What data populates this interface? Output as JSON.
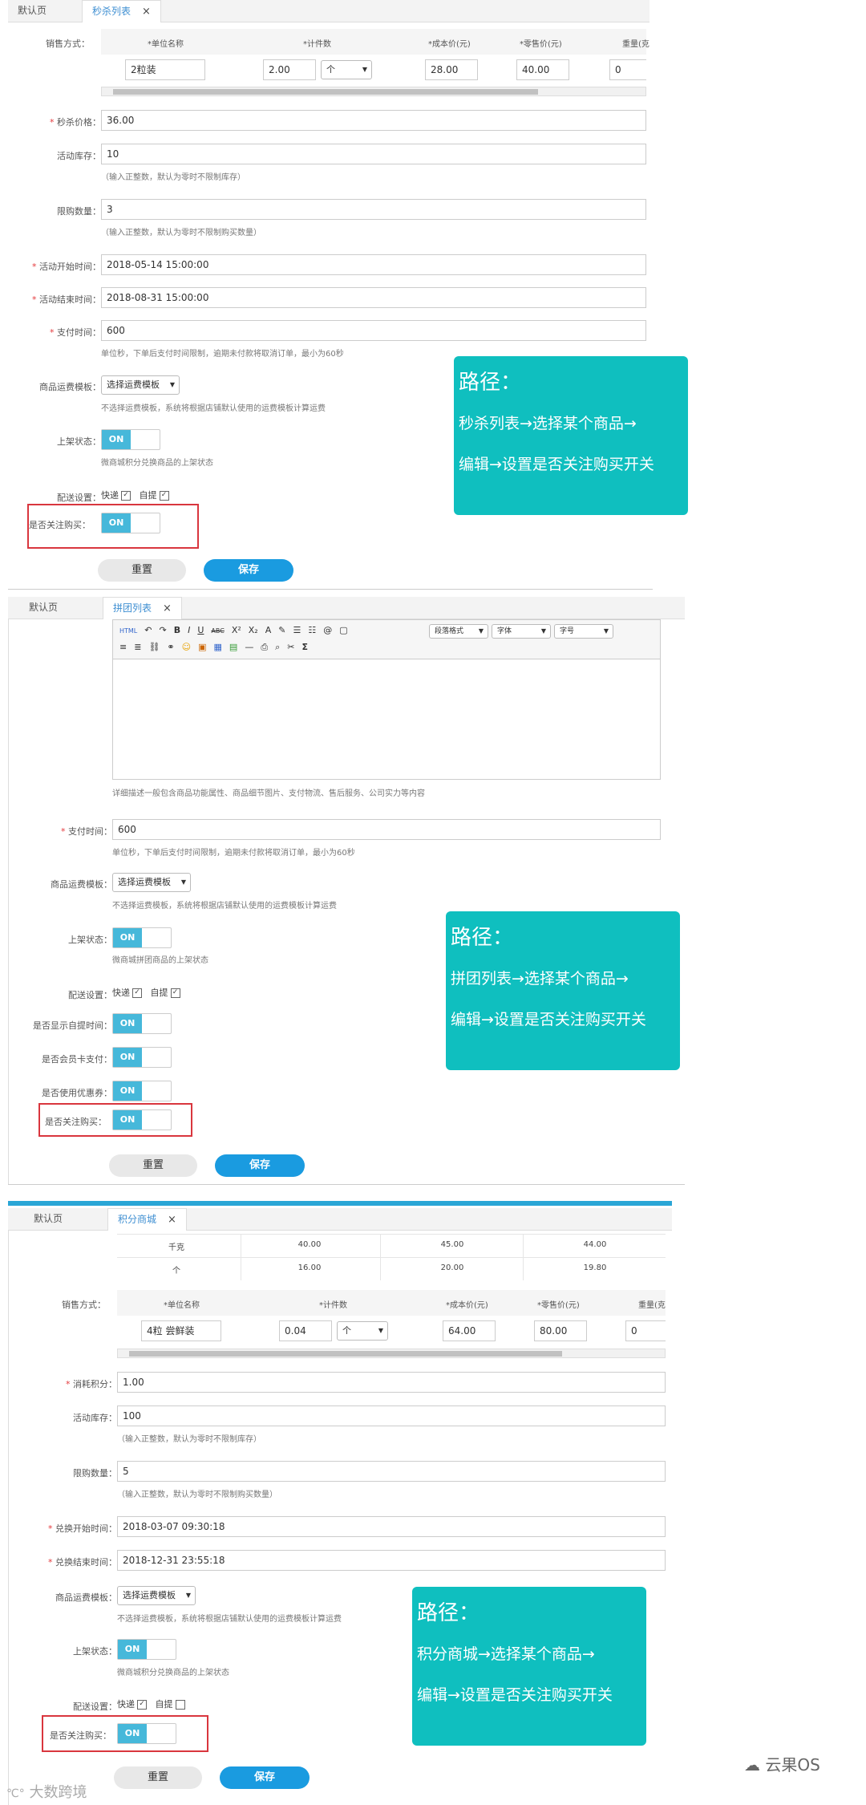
{
  "section1": {
    "tabs": [
      "默认页",
      "秒杀列表"
    ],
    "close_glyph": "×",
    "sale_label": "销售方式：",
    "columns": [
      "*单位名称",
      "*计件数",
      "*成本价(元)",
      "*零售价(元)",
      "重量(克"
    ],
    "row": {
      "unit": "2粒装",
      "count": "2.00",
      "count_unit": "个",
      "cost": "28.00",
      "retail": "40.00",
      "weight": "0"
    },
    "fields": [
      {
        "label": "秒杀价格：",
        "value": "36.00"
      },
      {
        "label": "活动库存：",
        "value": "10",
        "hint": "（输入正整数，默认为零时不限制库存）"
      },
      {
        "label": "限购数量：",
        "value": "3",
        "hint": "（输入正整数，默认为零时不限制购买数量）"
      },
      {
        "label": "活动开始时间：",
        "value": "2018-05-14 15:00:00"
      },
      {
        "label": "活动结束时间：",
        "value": "2018-08-31 15:00:00"
      },
      {
        "label": "支付时间：",
        "value": "600",
        "hint": "单位秒，下单后支付时间限制，逾期未付款将取消订单，最小为60秒"
      }
    ],
    "shipping_label": "商品运费模板：",
    "shipping_select": "选择运费模板",
    "shipping_hint": "不选择运费模板，系统将根据店铺默认使用的运费模板计算运费",
    "status_label": "上架状态：",
    "status_hint": "微商城积分兑换商品的上架状态",
    "delivery_label": "配送设置：",
    "delivery_options": [
      "快递",
      "自提"
    ],
    "follow_label": "是否关注购买：",
    "toggle_on": "ON",
    "reset": "重置",
    "save": "保存",
    "callout": {
      "title": "路径：",
      "line1": "秒杀列表→选择某个商品→",
      "line2": "编辑→设置是否关注购买开关"
    }
  },
  "section2": {
    "tabs": [
      "默认页",
      "拼团列表"
    ],
    "toolbar_row1": [
      "HTML",
      "↶",
      "↷",
      "B",
      "I",
      "U",
      "ABC",
      "X²",
      "X₂",
      "A",
      "✎",
      "☰",
      "☷",
      "@",
      "▢"
    ],
    "toolbar_selects": [
      "段落格式",
      "字体",
      "字号"
    ],
    "toolbar_row2": [
      "≡",
      "≣",
      "⛓",
      "⚭",
      "☺",
      "▣",
      "▦",
      "▤",
      "—",
      "⎙",
      "⌕",
      "✂",
      "Σ"
    ],
    "editor_hint": "详细描述一般包含商品功能属性、商品细节图片、支付物流、售后服务、公司实力等内容",
    "pay_label": "支付时间：",
    "pay_value": "600",
    "pay_hint": "单位秒，下单后支付时间限制，逾期未付款将取消订单，最小为60秒",
    "shipping_label": "商品运费模板：",
    "shipping_select": "选择运费模板",
    "shipping_hint": "不选择运费模板，系统将根据店铺默认使用的运费模板计算运费",
    "status_label": "上架状态：",
    "status_hint": "微商城拼团商品的上架状态",
    "delivery_label": "配送设置：",
    "delivery_options": [
      "快递",
      "自提"
    ],
    "toggles": [
      "是否显示自提时间：",
      "是否会员卡支付：",
      "是否使用优惠券：",
      "是否关注购买："
    ],
    "toggle_on": "ON",
    "reset": "重置",
    "save": "保存",
    "callout": {
      "title": "路径：",
      "line1": "拼团列表→选择某个商品→",
      "line2": "编辑→设置是否关注购买开关"
    }
  },
  "section3": {
    "tabs": [
      "默认页",
      "积分商城"
    ],
    "top_table": [
      [
        "千克",
        "40.00",
        "45.00",
        "44.00"
      ],
      [
        "个",
        "16.00",
        "20.00",
        "19.80"
      ]
    ],
    "sale_label": "销售方式：",
    "columns": [
      "*单位名称",
      "*计件数",
      "*成本价(元)",
      "*零售价(元)",
      "重量(克"
    ],
    "row": {
      "unit": "4粒 尝鲜装",
      "count": "0.04",
      "count_unit": "个",
      "cost": "64.00",
      "retail": "80.00",
      "weight": "0"
    },
    "fields": [
      {
        "label": "消耗积分：",
        "value": "1.00"
      },
      {
        "label": "活动库存：",
        "value": "100",
        "hint": "（输入正整数，默认为零时不限制库存）"
      },
      {
        "label": "限购数量：",
        "value": "5",
        "hint": "（输入正整数，默认为零时不限制购买数量）"
      },
      {
        "label": "兑换开始时间：",
        "value": "2018-03-07 09:30:18"
      },
      {
        "label": "兑换结束时间：",
        "value": "2018-12-31 23:55:18"
      }
    ],
    "shipping_label": "商品运费模板：",
    "shipping_select": "选择运费模板",
    "shipping_hint": "不选择运费模板，系统将根据店铺默认使用的运费模板计算运费",
    "status_label": "上架状态：",
    "status_hint": "微商城积分兑换商品的上架状态",
    "delivery_label": "配送设置：",
    "delivery_options": [
      "快递",
      "自提"
    ],
    "follow_label": "是否关注购买：",
    "toggle_on": "ON",
    "reset": "重置",
    "save": "保存",
    "callout": {
      "title": "路径：",
      "line1": "积分商城→选择某个商品→",
      "line2": "编辑→设置是否关注购买开关"
    }
  },
  "watermark": {
    "left": "大数跨境",
    "right": "云果OS"
  }
}
